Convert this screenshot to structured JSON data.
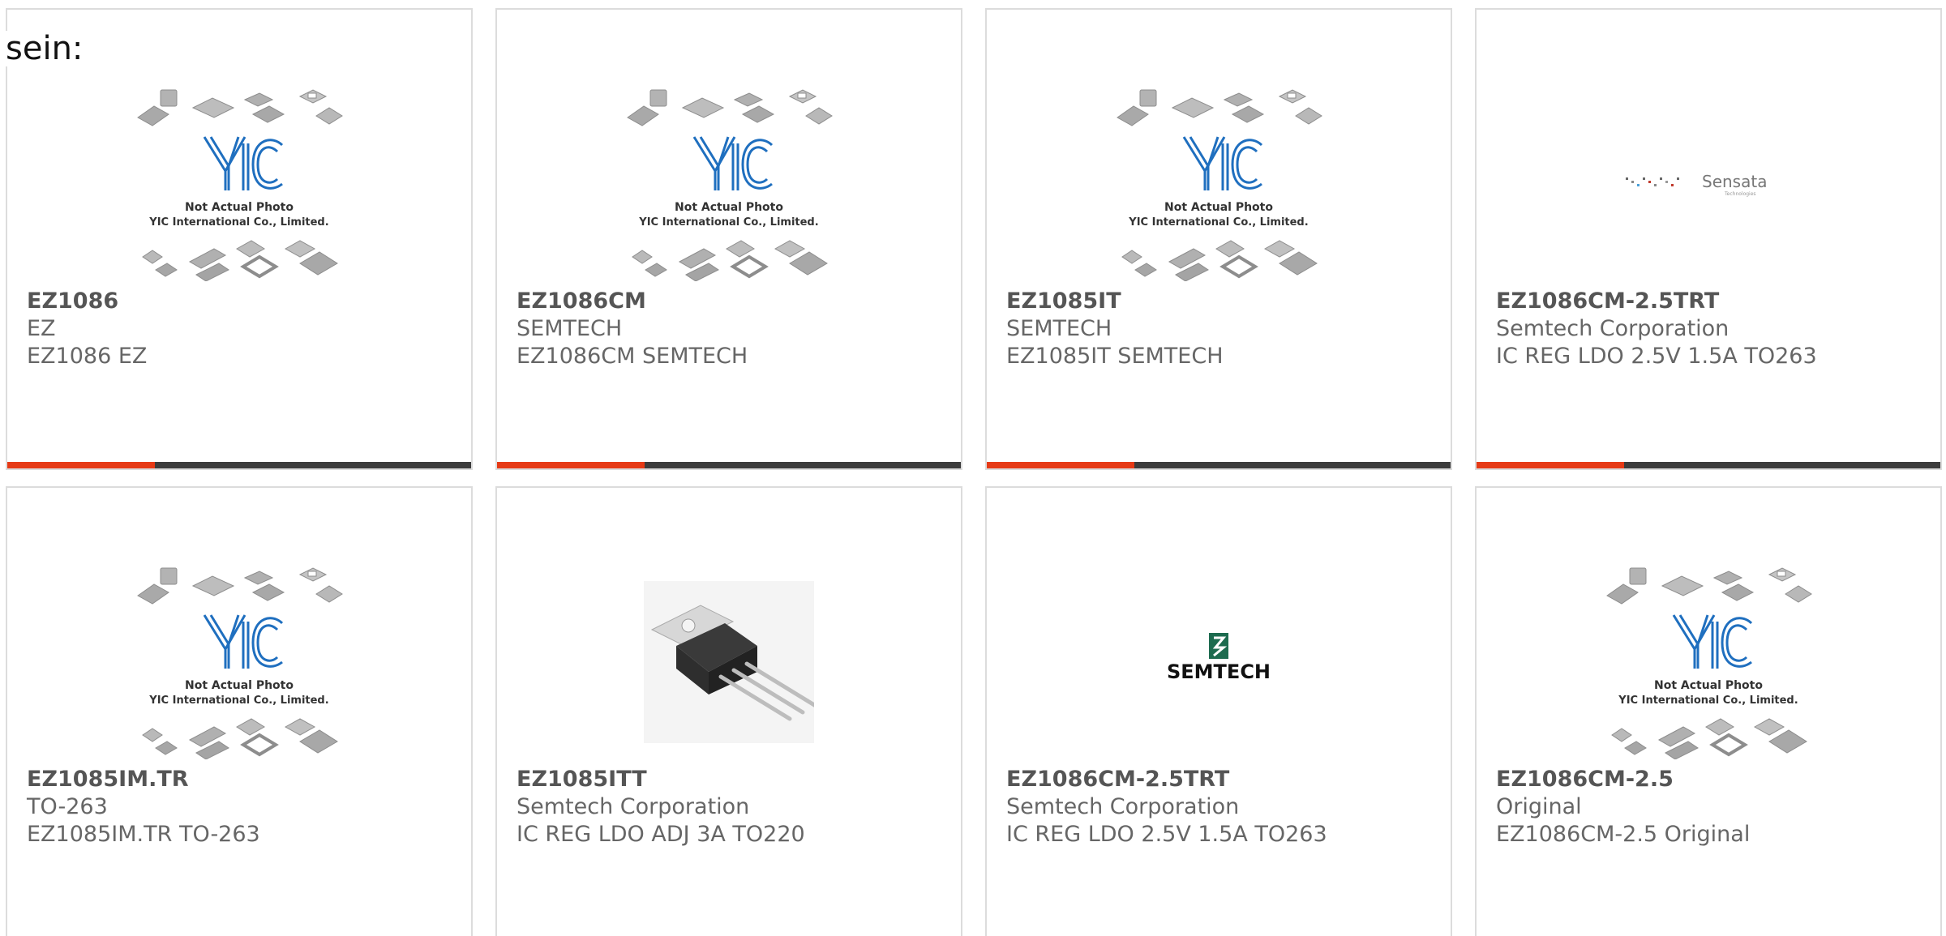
{
  "intro_text": "sein:",
  "accent_color": "#e63a16",
  "bar_color": "#3c3c3c",
  "photo_caption": {
    "line1": "Not Actual Photo",
    "line2": "YIC International Co., Limited."
  },
  "brand_texts": {
    "sensata": "Sensata",
    "sensata_sub": "Technologies",
    "semtech": "SEMTECH"
  },
  "cards": [
    {
      "part": "EZ1086",
      "manufacturer": "EZ",
      "description": "EZ1086 EZ",
      "image": "placeholder-yic"
    },
    {
      "part": "EZ1086CM",
      "manufacturer": "SEMTECH",
      "description": "EZ1086CM SEMTECH",
      "image": "placeholder-yic"
    },
    {
      "part": "EZ1085IT",
      "manufacturer": "SEMTECH",
      "description": "EZ1085IT SEMTECH",
      "image": "placeholder-yic"
    },
    {
      "part": "EZ1086CM-2.5TRT",
      "manufacturer": "Semtech Corporation",
      "description": "IC REG LDO 2.5V 1.5A TO263",
      "image": "sensata-logo"
    },
    {
      "part": "EZ1085IM.TR",
      "manufacturer": "TO-263",
      "description": "EZ1085IM.TR TO-263",
      "image": "placeholder-yic"
    },
    {
      "part": "EZ1085ITT",
      "manufacturer": "Semtech Corporation",
      "description": "IC REG LDO ADJ 3A TO220",
      "image": "to220-package-photo"
    },
    {
      "part": "EZ1086CM-2.5TRT",
      "manufacturer": "Semtech Corporation",
      "description": "IC REG LDO 2.5V 1.5A TO263",
      "image": "semtech-logo"
    },
    {
      "part": "EZ1086CM-2.5",
      "manufacturer": "Original",
      "description": "EZ1086CM-2.5 Original",
      "image": "placeholder-yic"
    }
  ]
}
